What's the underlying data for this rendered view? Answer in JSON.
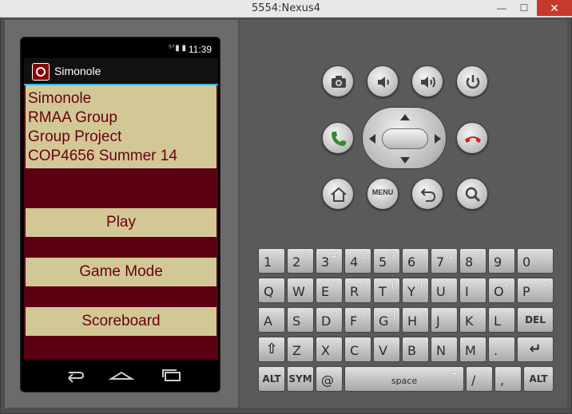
{
  "window": {
    "title": "5554:Nexus4",
    "minimize": "—",
    "maximize": "☐",
    "close": "✕"
  },
  "status_bar": {
    "icons": "⁵ᐟ▮ ▮",
    "time": "11:39"
  },
  "app": {
    "title": "Simonole",
    "info_lines": [
      "Simonole",
      "RMAA Group",
      "Group Project",
      "COP4656 Summer 14"
    ],
    "buttons": {
      "play": "Play",
      "game_mode": "Game Mode",
      "scoreboard": "Scoreboard"
    },
    "colors": {
      "background": "#5c0014",
      "panel": "#d2c896",
      "text": "#6a0013"
    }
  },
  "hardware_buttons": {
    "menu_label": "MENU",
    "call_color": "#2e8b2e",
    "end_color": "#d42020"
  },
  "keyboard": {
    "rows": [
      [
        {
          "m": "1",
          "a": "!"
        },
        {
          "m": "2",
          "a": "@"
        },
        {
          "m": "3",
          "a": "#"
        },
        {
          "m": "4",
          "a": "$"
        },
        {
          "m": "5",
          "a": "%"
        },
        {
          "m": "6",
          "a": "^"
        },
        {
          "m": "7",
          "a": "&"
        },
        {
          "m": "8",
          "a": "*"
        },
        {
          "m": "9",
          "a": "("
        },
        {
          "m": "0",
          "a": ")"
        }
      ],
      [
        {
          "m": "Q",
          "a": ""
        },
        {
          "m": "W",
          "a": "~"
        },
        {
          "m": "E",
          "a": "\""
        },
        {
          "m": "R",
          "a": "`"
        },
        {
          "m": "T",
          "a": "{"
        },
        {
          "m": "Y",
          "a": "}"
        },
        {
          "m": "U",
          "a": "-"
        },
        {
          "m": "I",
          "a": "-"
        },
        {
          "m": "O",
          "a": "+"
        },
        {
          "m": "P",
          "a": "="
        }
      ],
      [
        {
          "m": "A",
          "a": ""
        },
        {
          "m": "S",
          "a": "\\"
        },
        {
          "m": "D",
          "a": "'"
        },
        {
          "m": "F",
          "a": "["
        },
        {
          "m": "G",
          "a": "]"
        },
        {
          "m": "H",
          "a": "<"
        },
        {
          "m": "J",
          "a": ">"
        },
        {
          "m": "K",
          "a": ";"
        },
        {
          "m": "L",
          "a": ":"
        },
        {
          "m": "DEL",
          "a": ""
        }
      ],
      [
        {
          "m": "⇧",
          "a": ""
        },
        {
          "m": "Z",
          "a": ""
        },
        {
          "m": "X",
          "a": ""
        },
        {
          "m": "C",
          "a": ""
        },
        {
          "m": "V",
          "a": ""
        },
        {
          "m": "B",
          "a": ""
        },
        {
          "m": "N",
          "a": ""
        },
        {
          "m": "M",
          "a": ""
        },
        {
          "m": ".",
          "a": ""
        },
        {
          "m": "↵",
          "a": ""
        }
      ],
      [
        {
          "m": "ALT",
          "a": ""
        },
        {
          "m": "SYM",
          "a": ""
        },
        {
          "m": "@",
          "a": ""
        },
        {
          "m": "space",
          "a": "→|"
        },
        {
          "m": "/",
          "a": "?"
        },
        {
          "m": ",",
          "a": "!"
        },
        {
          "m": "ALT",
          "a": ""
        }
      ]
    ]
  }
}
